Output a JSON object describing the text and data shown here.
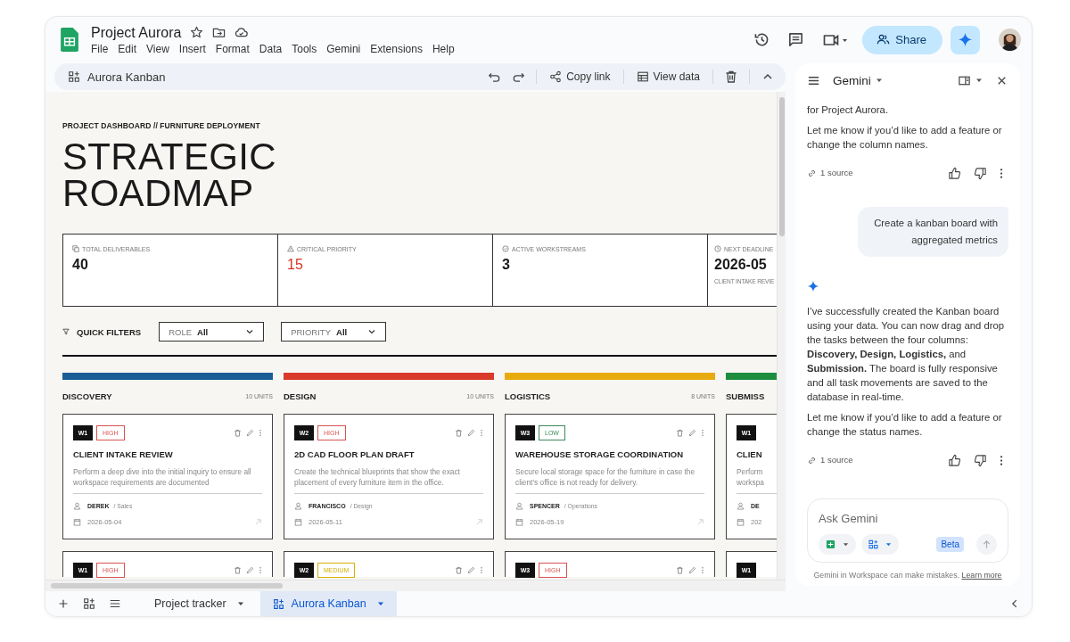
{
  "document": {
    "title": "Project Aurora"
  },
  "menu": [
    "File",
    "Edit",
    "View",
    "Insert",
    "Format",
    "Data",
    "Tools",
    "Gemini",
    "Extensions",
    "Help"
  ],
  "header": {
    "share": "Share"
  },
  "toolbar": {
    "title": "Aurora Kanban",
    "actions": [
      {
        "kind": "undo"
      },
      {
        "kind": "redo"
      },
      {
        "kind": "copy-link",
        "label": "Copy link"
      },
      {
        "kind": "view-data",
        "label": "View data"
      },
      {
        "kind": "delete"
      },
      {
        "kind": "collapse"
      }
    ]
  },
  "dashboard": {
    "eyebrow": "PROJECT DASHBOARD // FURNITURE DEPLOYMENT",
    "title_lines": [
      "STRATEGIC",
      "ROADMAP"
    ],
    "metrics": [
      {
        "kind": "deliverables",
        "label": "TOTAL DELIVERABLES",
        "value": "40",
        "alert": false
      },
      {
        "kind": "critical",
        "label": "CRITICAL PRIORITY",
        "value": "15",
        "alert": true
      },
      {
        "kind": "workstreams",
        "label": "ACTIVE WORKSTREAMS",
        "value": "3",
        "alert": false
      },
      {
        "kind": "deadline",
        "label": "NEXT DEADLINE",
        "value": "2026-05",
        "note": "CLIENT INTAKE REVIE",
        "alert": false
      }
    ],
    "filters": {
      "label": "QUICK FILTERS",
      "dropdowns": [
        {
          "label": "ROLE",
          "value": "All"
        },
        {
          "label": "PRIORITY",
          "value": "All"
        }
      ]
    },
    "columns": [
      {
        "name": "DISCOVERY",
        "count": "10 UNITS",
        "color": "#1b5e96",
        "cards": [
          {
            "workstream": "W1",
            "priority": {
              "label": "HIGH",
              "color": "#d9534f"
            },
            "title": "CLIENT INTAKE REVIEW",
            "description": "Perform a deep dive into the initial inquiry to ensure all workspace requirements are documented",
            "owner": "DEREK",
            "role": "/ Sales",
            "due": "2026-05-04"
          },
          {
            "workstream": "W1",
            "priority": {
              "label": "HIGH",
              "color": "#d9534f"
            }
          }
        ]
      },
      {
        "name": "DESIGN",
        "count": "10 UNITS",
        "color": "#d93a2b",
        "cards": [
          {
            "workstream": "W2",
            "priority": {
              "label": "HIGH",
              "color": "#d9534f"
            },
            "title": "2D CAD FLOOR PLAN DRAFT",
            "description": "Create the technical blueprints that show the exact placement of every furniture item in the office.",
            "owner": "FRANCISCO",
            "role": "/ Design",
            "due": "2026-05-11"
          },
          {
            "workstream": "W2",
            "priority": {
              "label": "MEDIUM",
              "color": "#d4b106"
            }
          }
        ]
      },
      {
        "name": "LOGISTICS",
        "count": "8 UNITS",
        "color": "#e8ab0f",
        "cards": [
          {
            "workstream": "W3",
            "priority": {
              "label": "LOW",
              "color": "#3a8a5a"
            },
            "title": "WAREHOUSE STORAGE COORDINATION",
            "description": "Secure local storage space for the furniture in case the client’s office is not ready for delivery.",
            "owner": "SPENCER",
            "role": "/ Operations",
            "due": "2026-05-19"
          },
          {
            "workstream": "W3",
            "priority": {
              "label": "HIGH",
              "color": "#d9534f"
            }
          }
        ]
      },
      {
        "name": "SUBMISS",
        "color": "#1e8e3e",
        "cards": [
          {
            "workstream": "W1",
            "title": "CLIEN",
            "description": "Perform workspa",
            "owner": "DE",
            "due": "202"
          },
          {
            "workstream": "W1"
          }
        ]
      }
    ]
  },
  "gemini": {
    "title": "Gemini",
    "messages": [
      {
        "kind": "response",
        "paragraphs": [
          "for Project Aurora.",
          "Let me know if you’d like to add a feature or change the column names."
        ],
        "sources": "1 source"
      },
      {
        "kind": "prompt",
        "text": "Create a kanban board with aggregated metrics"
      },
      {
        "kind": "response",
        "paragraphs": [
          "I’ve successfully created the Kanban board using your data. You can now drag and drop the tasks between the four columns: **Discovery, Design, Logistics,** and **Submission.** The board is fully responsive and all task movements are saved to the database in real-time.",
          "Let me know if you’d like to add a feature or change the status names."
        ],
        "sources": "1 source",
        "spark": true
      }
    ],
    "input": {
      "placeholder": "Ask Gemini",
      "badge": "Beta"
    },
    "disclaimer": "Gemini in Workspace can make mistakes.",
    "link": "Learn more"
  },
  "sheet_tabs": [
    {
      "label": "Project tracker",
      "selected": false
    },
    {
      "label": "Aurora Kanban",
      "selected": true
    }
  ]
}
